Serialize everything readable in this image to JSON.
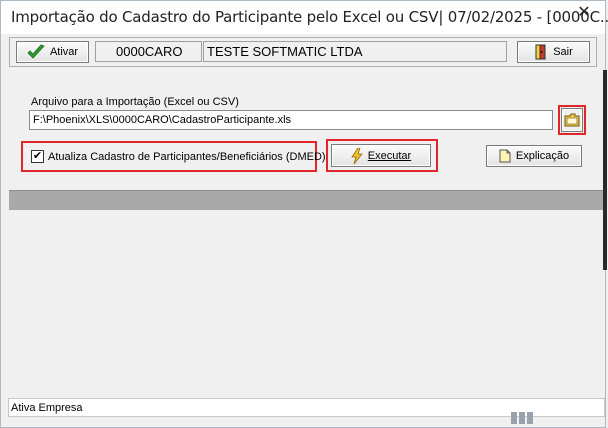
{
  "window": {
    "title": "Importação do Cadastro do Participante pelo Excel ou CSV|  07/02/2025 - [0000C...",
    "close_glyph": "✕"
  },
  "toolbar": {
    "ativar_label": "Ativar",
    "company_code": "0000CARO",
    "company_name": "TESTE SOFTMATIC LTDA",
    "sair_label": "Sair"
  },
  "form": {
    "file_label": "Arquivo para a Importação (Excel ou CSV)",
    "file_value": "F:\\Phoenix\\XLS\\0000CARO\\CadastroParticipante.xls",
    "checkbox_label": "Atualiza Cadastro de Participantes/Beneficiários (DMED)",
    "checkbox_checked": true,
    "executar_label": "Executar",
    "explicacao_label": "Explicação"
  },
  "status": {
    "text": "Ativa Empresa"
  },
  "icons": {
    "ativar": "check-icon",
    "sair": "exit-door-icon",
    "browse": "folder-icon",
    "executar": "lightning-icon",
    "explicacao": "document-icon"
  },
  "colors": {
    "highlight": "#e0262b",
    "divider": "#a9a9a9",
    "check_green": "#2e9b2e"
  }
}
